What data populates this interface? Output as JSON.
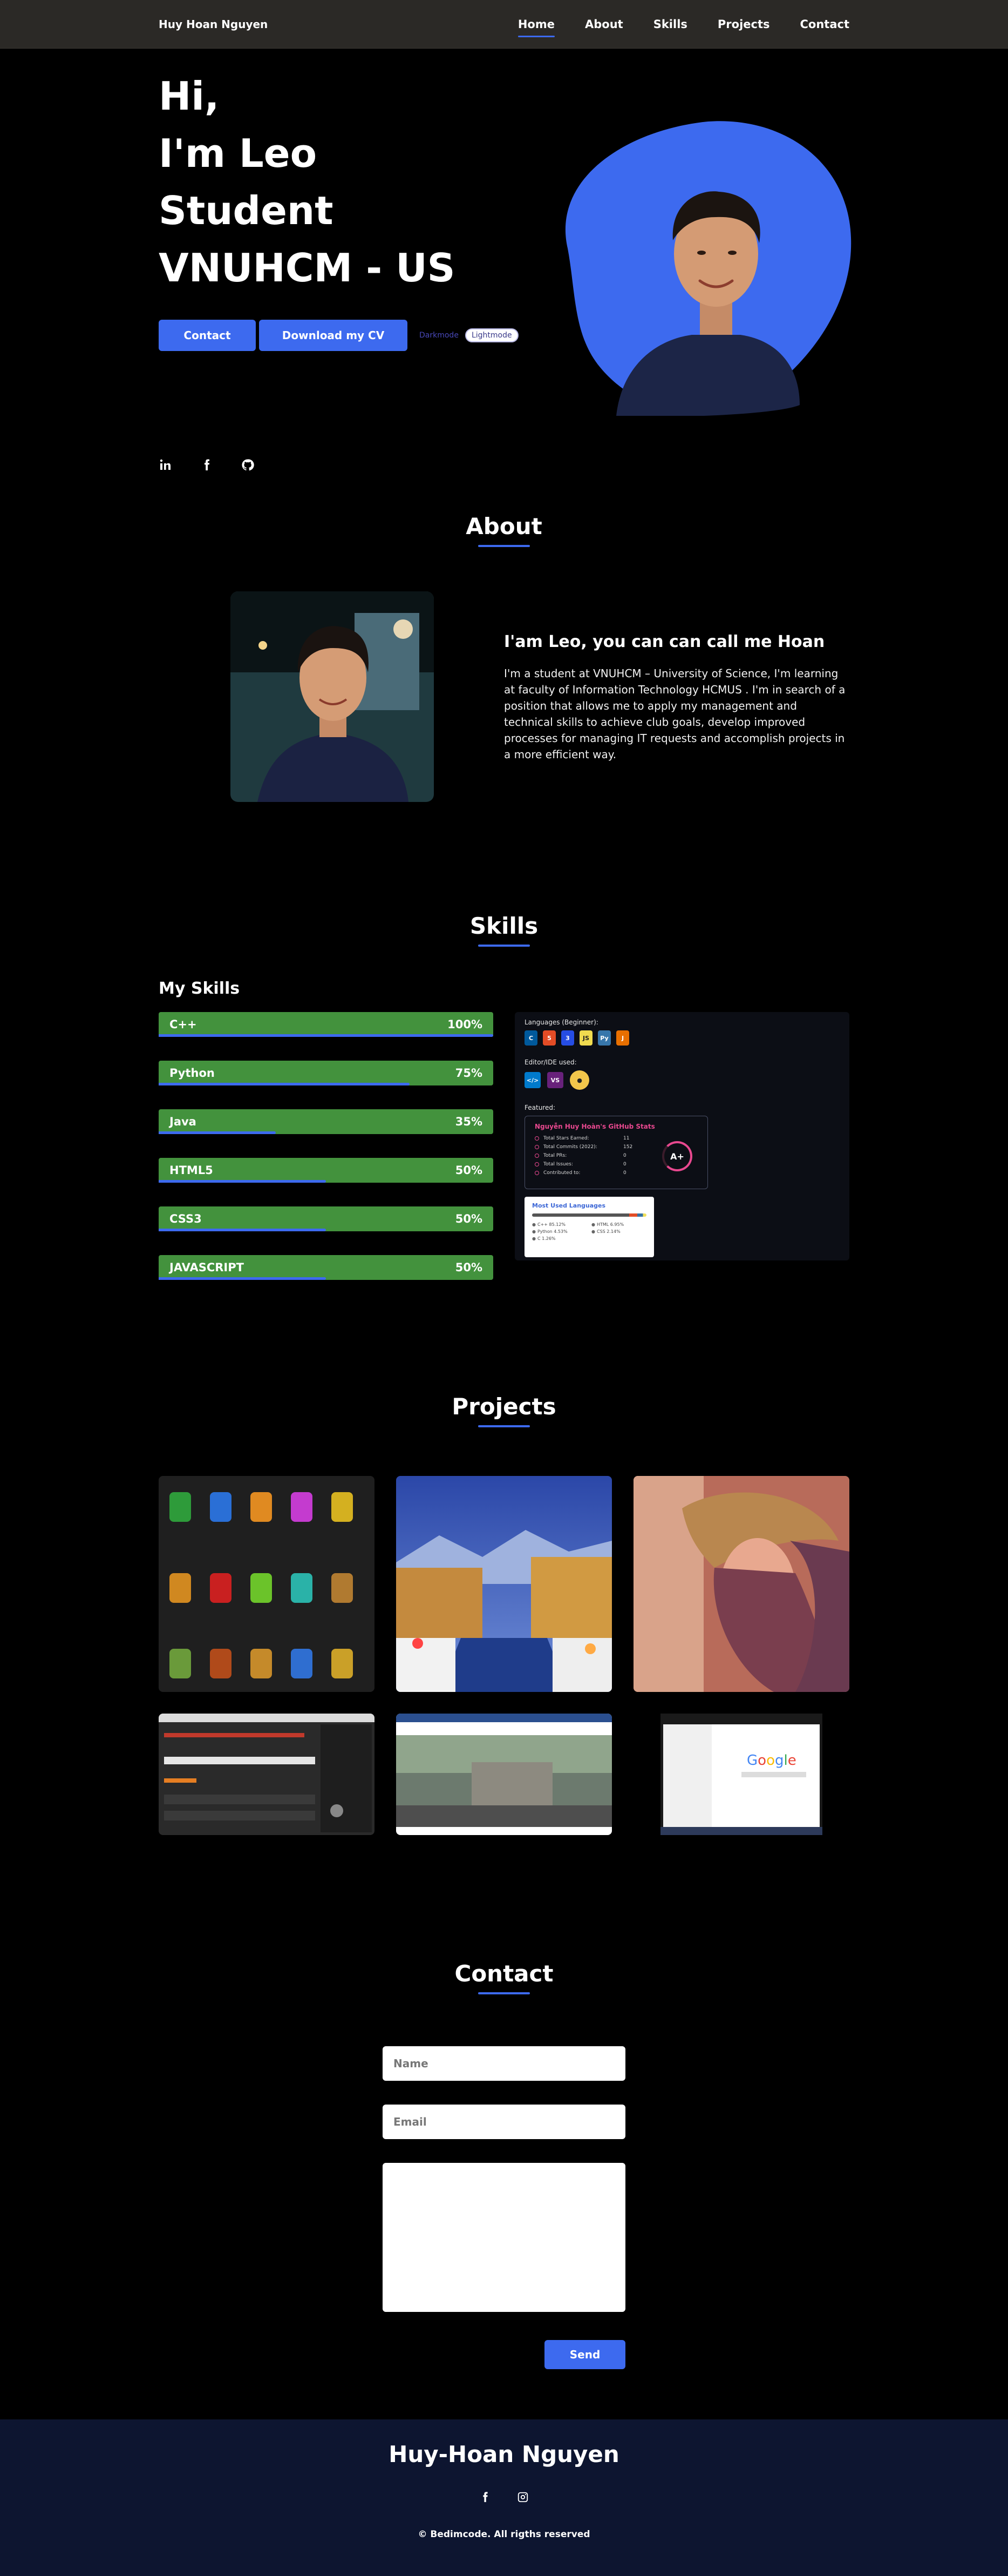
{
  "nav": {
    "brand": "Huy Hoan Nguyen",
    "items": [
      {
        "label": "Home",
        "active": true
      },
      {
        "label": "About",
        "active": false
      },
      {
        "label": "Skills",
        "active": false
      },
      {
        "label": "Projects",
        "active": false
      },
      {
        "label": "Contact",
        "active": false
      }
    ]
  },
  "hero": {
    "lines": [
      "Hi,",
      "I'm Leo",
      "Student",
      "VNUHCM - US"
    ],
    "contact_button": "Contact",
    "cv_button": "Download my CV",
    "dark_label": "Darkmode",
    "mode_toggle": "Lightmode",
    "socials": [
      "linkedin-icon",
      "facebook-icon",
      "github-icon"
    ],
    "accent": "#3d6aef"
  },
  "about": {
    "title": "About",
    "heading": "I'am Leo, you can can call me Hoan",
    "paragraph": "I'm a student at VNUHCM – University of Science, I'm learning at faculty of Information Technology HCMUS . I'm in search of a position that allows me to apply my management and technical skills to achieve club goals, develop improved processes for managing IT requests and accomplish projects in a more efficient way."
  },
  "skills": {
    "title": "Skills",
    "heading": "My Skills",
    "items": [
      {
        "name": "C++",
        "percent": "100%",
        "level": 1.0
      },
      {
        "name": "Python",
        "percent": "75%",
        "level": 0.75
      },
      {
        "name": "Java",
        "percent": "35%",
        "level": 0.35
      },
      {
        "name": "HTML5",
        "percent": "50%",
        "level": 0.5
      },
      {
        "name": "CSS3",
        "percent": "50%",
        "level": 0.5
      },
      {
        "name": "JAVASCRIPT",
        "percent": "50%",
        "level": 0.5
      }
    ],
    "bar_color": "#43923d",
    "card": {
      "languages_label": "Languages (Beginner):",
      "editors_label": "Editor/IDE used:",
      "featured_label": "Featured:",
      "stats_title": "Nguyễn Huy Hoàn's GitHub Stats",
      "stats": [
        {
          "label": "Total Stars Earned:",
          "value": "11"
        },
        {
          "label": "Total Commits (2022):",
          "value": "152"
        },
        {
          "label": "Total PRs:",
          "value": "0"
        },
        {
          "label": "Total Issues:",
          "value": "0"
        },
        {
          "label": "Contributed to:",
          "value": "0"
        }
      ],
      "grade": "A+",
      "lang_title": "Most Used Languages",
      "langs": [
        "C++ 85.12%",
        "HTML 6.95%",
        "Python 4.53%",
        "CSS 2.14%",
        "C 1.26%"
      ]
    }
  },
  "projects": {
    "title": "Projects"
  },
  "contact": {
    "title": "Contact",
    "name_placeholder": "Name",
    "email_placeholder": "Email",
    "send_button": "Send"
  },
  "footer": {
    "name": "Huy-Hoan Nguyen",
    "copyright": "© Bedimcode. All rigths reserved"
  }
}
